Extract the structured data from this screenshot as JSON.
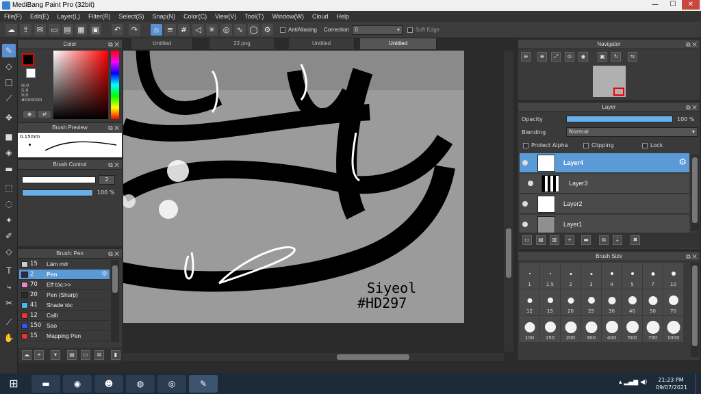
{
  "window": {
    "title": "MediBang Paint Pro (32bit)",
    "minimize": "—",
    "maximize": "☐",
    "close": "✕"
  },
  "menu": [
    "File(F)",
    "Edit(E)",
    "Layer(L)",
    "Filter(R)",
    "Select(S)",
    "Snap(N)",
    "Color(C)",
    "View(V)",
    "Tool(T)",
    "Window(W)",
    "Cloud",
    "Help"
  ],
  "toolbar": {
    "antialias_label": "AntiAliasing",
    "correction_label": "Correction",
    "correction_value": "0",
    "soft_edge_label": "Soft Edge"
  },
  "tabs": [
    "Untitled",
    "22.png",
    "Untitled",
    "Untitled"
  ],
  "color_panel": {
    "title": "Color",
    "h": "H:0",
    "s": "S:0",
    "v": "V:0",
    "hex": "#000000",
    "fg": "#000000",
    "bg": "#ffffff"
  },
  "brush_preview": {
    "title": "Brush Preview",
    "size": "0.15mm"
  },
  "brush_control": {
    "title": "Brush Control",
    "size_value": "2",
    "opacity_value": "100 %"
  },
  "brush_list": {
    "title": "Brush: Pen",
    "items": [
      {
        "size": "15",
        "name": "Làm mờ",
        "color": "#cccccc"
      },
      {
        "size": "2",
        "name": "Pen",
        "color": "#2a2a4a"
      },
      {
        "size": "70",
        "name": "Eff tóc:>>",
        "color": "#e888c8"
      },
      {
        "size": "20",
        "name": "Pen (Sharp)",
        "color": "#2a2a2a"
      },
      {
        "size": "41",
        "name": "Shade tóc",
        "color": "#44bbee"
      },
      {
        "size": "12",
        "name": "Calli",
        "color": "#ee3333"
      },
      {
        "size": "150",
        "name": "Sao",
        "color": "#3355ee"
      },
      {
        "size": "15",
        "name": "Mapping Pen",
        "color": "#ee3333"
      }
    ]
  },
  "navigator": {
    "title": "Navigator"
  },
  "layer_panel": {
    "title": "Layer",
    "opacity_label": "Opacity",
    "opacity_value": "100 %",
    "blending_label": "Blending",
    "blending_value": "Normal",
    "protect_alpha": "Protect Alpha",
    "clipping": "Clipping",
    "lock": "Lock",
    "layers": [
      "Layer4",
      "Layer3",
      "Layer2",
      "Layer1"
    ]
  },
  "brush_size": {
    "title": "Brush Size",
    "sizes": [
      "1",
      "1.5",
      "2",
      "3",
      "4",
      "5",
      "7",
      "10",
      "12",
      "15",
      "20",
      "25",
      "30",
      "40",
      "50",
      "70",
      "100",
      "150",
      "200",
      "300",
      "400",
      "500",
      "700",
      "1000"
    ]
  },
  "canvas": {
    "signature_line1": "Siyeol",
    "signature_line2": "#HD297"
  },
  "taskbar": {
    "time": "21:23 PM",
    "date": "09/07/2021"
  }
}
